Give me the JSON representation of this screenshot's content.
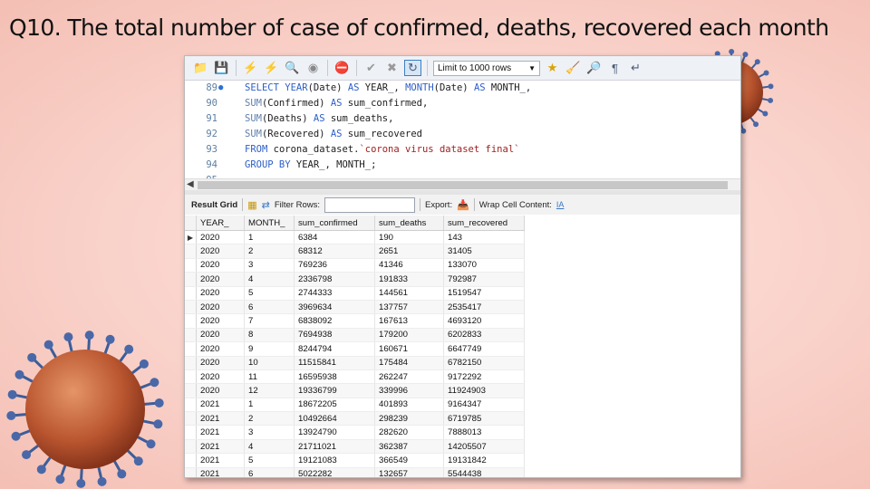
{
  "slide": {
    "title": "Q10. The total number of case of confirmed, deaths, recovered each month"
  },
  "toolbar": {
    "limit_label": "Limit to 1000 rows",
    "buttons": [
      "folder-icon",
      "save-icon",
      "execute-icon",
      "execute-current-icon",
      "explain-icon",
      "stop-icon",
      "toggle-error-icon",
      "commit-icon",
      "rollback-icon",
      "autocommit-icon",
      "limit-rows",
      "bookmark-icon",
      "beautify-icon",
      "find-icon",
      "invisible-chars-icon",
      "wrap-icon"
    ]
  },
  "editor": {
    "lines": [
      {
        "num": "89",
        "code": "SELECT YEAR(Date) AS YEAR_, MONTH(Date) AS MONTH_,"
      },
      {
        "num": "90",
        "code": "SUM(Confirmed) AS sum_confirmed,"
      },
      {
        "num": "91",
        "code": "SUM(Deaths) AS sum_deaths,"
      },
      {
        "num": "92",
        "code": "SUM(Recovered) AS sum_recovered"
      },
      {
        "num": "93",
        "code": "FROM corona_dataset.`corona virus dataset final`"
      },
      {
        "num": "94",
        "code": "GROUP BY YEAR_, MONTH_;"
      },
      {
        "num": "95",
        "code": ""
      }
    ]
  },
  "result_bar": {
    "result_grid_label": "Result Grid",
    "filter_label": "Filter Rows:",
    "filter_value": "",
    "export_label": "Export:",
    "wrap_label": "Wrap Cell Content:"
  },
  "grid": {
    "columns": [
      "YEAR_",
      "MONTH_",
      "sum_confirmed",
      "sum_deaths",
      "sum_recovered"
    ],
    "rows": [
      [
        "2020",
        "1",
        "6384",
        "190",
        "143"
      ],
      [
        "2020",
        "2",
        "68312",
        "2651",
        "31405"
      ],
      [
        "2020",
        "3",
        "769236",
        "41346",
        "133070"
      ],
      [
        "2020",
        "4",
        "2336798",
        "191833",
        "792987"
      ],
      [
        "2020",
        "5",
        "2744333",
        "144561",
        "1519547"
      ],
      [
        "2020",
        "6",
        "3969634",
        "137757",
        "2535417"
      ],
      [
        "2020",
        "7",
        "6838092",
        "167613",
        "4693120"
      ],
      [
        "2020",
        "8",
        "7694938",
        "179200",
        "6202833"
      ],
      [
        "2020",
        "9",
        "8244794",
        "160671",
        "6647749"
      ],
      [
        "2020",
        "10",
        "11515841",
        "175484",
        "6782150"
      ],
      [
        "2020",
        "11",
        "16595938",
        "262247",
        "9172292"
      ],
      [
        "2020",
        "12",
        "19336799",
        "339996",
        "11924903"
      ],
      [
        "2021",
        "1",
        "18672205",
        "401893",
        "9164347"
      ],
      [
        "2021",
        "2",
        "10492664",
        "298239",
        "6719785"
      ],
      [
        "2021",
        "3",
        "13924790",
        "282620",
        "7888013"
      ],
      [
        "2021",
        "4",
        "21711021",
        "362387",
        "14205507"
      ],
      [
        "2021",
        "5",
        "19121083",
        "366549",
        "19131842"
      ],
      [
        "2021",
        "6",
        "5022282",
        "132657",
        "5544438"
      ]
    ]
  },
  "decor": {
    "virus_body_color": "#c7643a",
    "virus_spike_color": "#4a68a8"
  }
}
